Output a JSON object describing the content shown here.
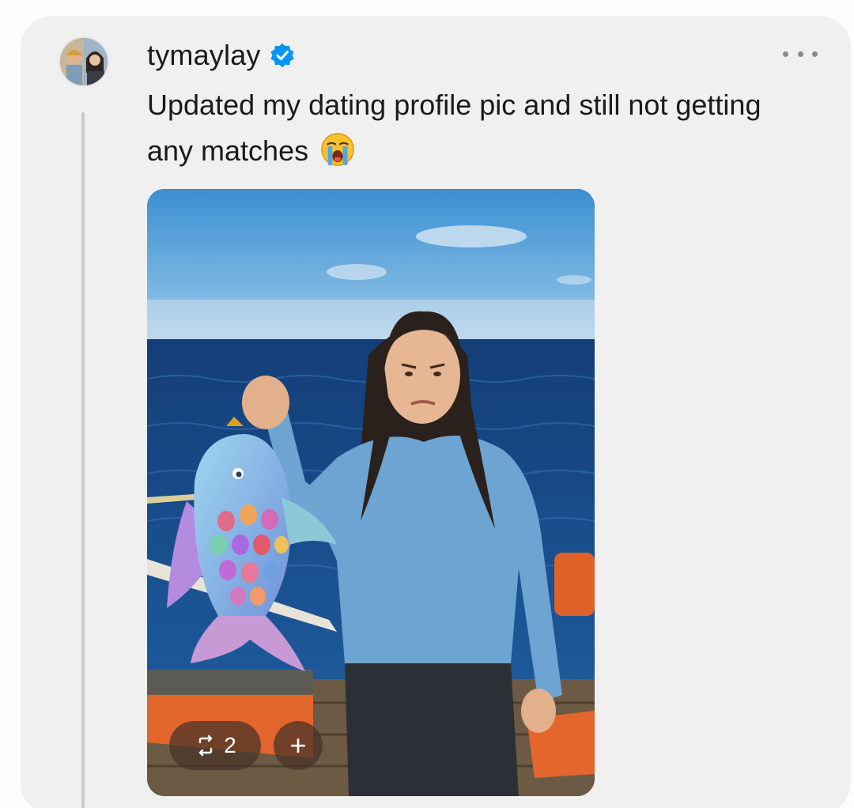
{
  "post": {
    "username": "tymaylay",
    "verified": true,
    "text": "Updated my dating profile pic and still not getting any matches",
    "emoji": "loudly-crying-face",
    "image_alt": "Photo of a woman on a boat at sea holding up a cartoon rainbow fish"
  },
  "overlay": {
    "repost_count": "2",
    "add_label": "+"
  },
  "icons": {
    "more": "more-options-icon",
    "repost": "repost-icon",
    "verified": "verified-badge-icon"
  },
  "colors": {
    "card_bg": "#f0f0f0",
    "verified_blue": "#0095f6",
    "thread_line": "#c9c9c9"
  }
}
